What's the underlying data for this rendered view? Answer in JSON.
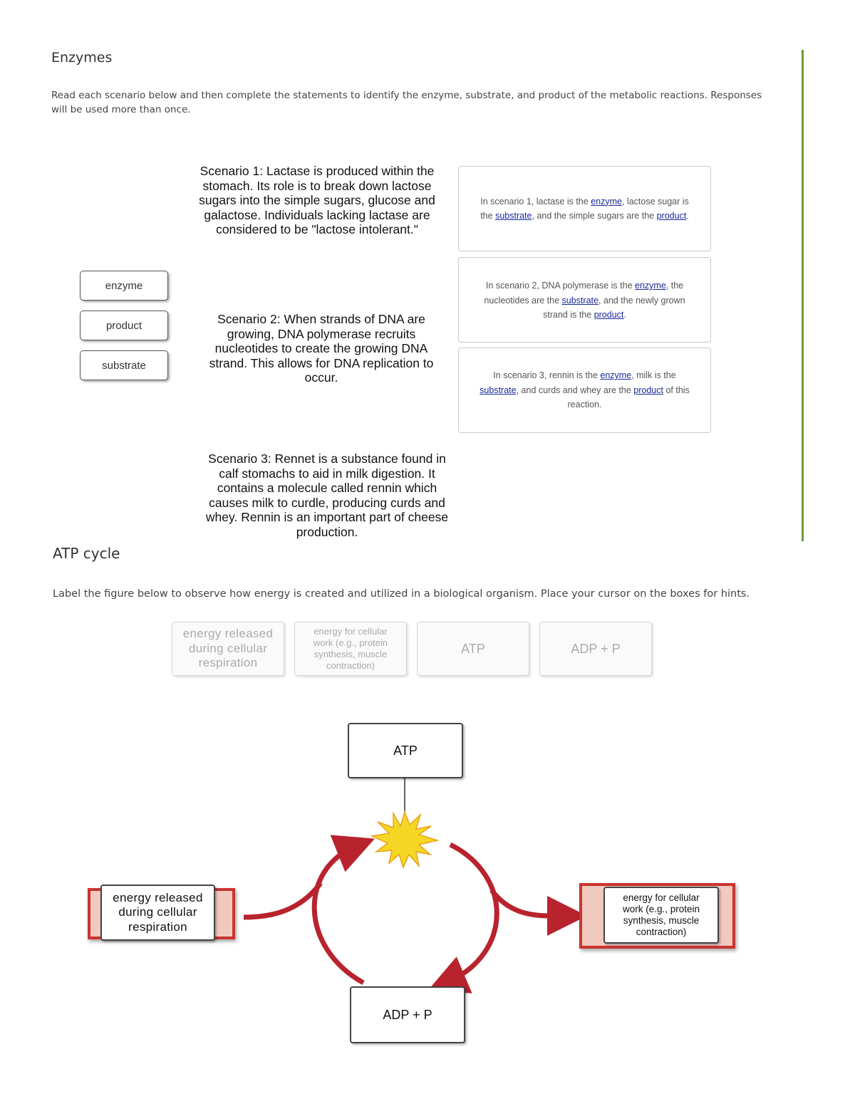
{
  "enzymes": {
    "title": "Enzymes",
    "instructions": "Read each scenario below and then complete the statements to identify the enzyme, substrate, and product of the metabolic reactions. Responses will be used more than once.",
    "instructions_line1": "Read each scenario below and then complete the statements to identify the enzyme, substrate, and product of the metabolic reactions. Responses",
    "instructions_line2": "will be used more than once.",
    "drag_labels": [
      "enzyme",
      "product",
      "substrate"
    ],
    "scenarios": [
      {
        "lines": [
          "Scenario 1: Lactase is produced within the",
          "stomach.  Its role is to break down lactose",
          "sugars into the simple sugars, glucose and",
          "galactose. Individuals lacking lactase are",
          "considered to be \"lactose intolerant.\""
        ]
      },
      {
        "lines": [
          "Scenario 2: When strands of DNA are",
          "growing, DNA polymerase recruits",
          "nucleotides to create the growing DNA",
          "strand. This allows for DNA replication to",
          "occur."
        ]
      },
      {
        "lines": [
          "Scenario 3: Rennet is a substance found in",
          "calf stomachs to aid in milk digestion. It",
          "contains a molecule called rennin which",
          "causes milk to curdle, producing curds and",
          "whey.  Rennin is an important part of cheese",
          "production."
        ]
      }
    ],
    "statements": [
      {
        "t1": "In scenario 1, lactase is the ",
        "b1": "enzyme",
        "t2": ", lactose sugar is the ",
        "b2": "substrate",
        "t3": ", and the simple sugars are the ",
        "b3": "product",
        "t4": "."
      },
      {
        "t1": "In scenario 2, DNA polymerase is the ",
        "b1": "enzyme",
        "t2": ", the nucleotides are the ",
        "b2": "substrate",
        "t3": ", and the newly grown strand is the ",
        "b3": "product",
        "t4": "."
      },
      {
        "t1": "In scenario 3, rennin is the ",
        "b1": "enzyme",
        "t2": ", milk is the ",
        "b2": "substrate",
        "t3": ", and curds and whey are the ",
        "b3": "product",
        "t4": " of this reaction."
      }
    ]
  },
  "atp_cycle": {
    "title": "ATP cycle",
    "instructions": "Label the figure below to observe how energy is created and utilized in a biological organism. Place your cursor on the boxes for hints.",
    "label_bank": [
      {
        "text": "energy released during cellular respiration"
      },
      {
        "text": "energy for cellular work (e.g., protein synthesis, muscle contraction)"
      },
      {
        "text": "ATP"
      },
      {
        "text": "ADP + P"
      }
    ],
    "figure": {
      "top_box": "ATP",
      "bottom_box": "ADP + P",
      "left_box": "energy released during cellular respiration",
      "right_box": "energy for cellular work (e.g., protein synthesis, muscle contraction)",
      "arrow_color": "#b8232d",
      "frame_color": "#c9342f",
      "burst_color": "#f5d020"
    }
  }
}
